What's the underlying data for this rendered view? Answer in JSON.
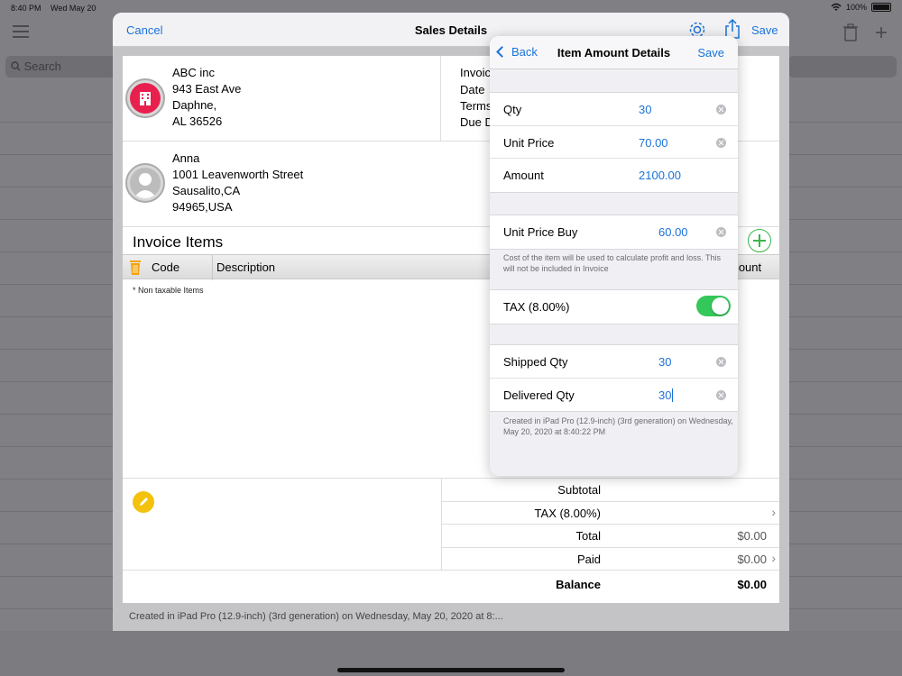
{
  "status_bar": {
    "time": "8:40 PM",
    "date": "Wed May 20",
    "battery": "100%"
  },
  "background": {
    "search_placeholder": "Search"
  },
  "sheet": {
    "cancel_label": "Cancel",
    "title": "Sales Details",
    "save_label": "Save",
    "company": {
      "name": "ABC inc",
      "street": "943 East Ave",
      "city": "Daphne,",
      "state_zip": "AL 36526"
    },
    "invoice_meta": {
      "invoice": "Invoic",
      "date": "Date",
      "terms": "Terms",
      "due": "Due D"
    },
    "client": {
      "name": "Anna",
      "street": "1001  Leavenworth Street",
      "city": "Sausalito,CA",
      "zip": "94965,USA"
    },
    "items_title": "Invoice Items",
    "columns": {
      "code": "Code",
      "description": "Description",
      "amount": "mount"
    },
    "nontax_note": "* Non taxable Items",
    "totals": [
      {
        "label": "Subtotal",
        "value": "",
        "chevron": false
      },
      {
        "label": "TAX (8.00%)",
        "value": "",
        "chevron": true
      },
      {
        "label": "Total",
        "value": "$0.00",
        "chevron": false
      },
      {
        "label": "Paid",
        "value": "$0.00",
        "chevron": true
      }
    ],
    "balance": {
      "label": "Balance",
      "value": "$0.00"
    },
    "footer_note": "Created in iPad Pro (12.9-inch) (3rd generation) on Wednesday, May 20, 2020 at 8:..."
  },
  "popover": {
    "back_label": "Back",
    "title": "Item Amount Details",
    "save_label": "Save",
    "qty": {
      "label": "Qty",
      "value": "30"
    },
    "unit_price": {
      "label": "Unit Price",
      "value": "70.00"
    },
    "amount": {
      "label": "Amount",
      "value": "2100.00"
    },
    "unit_price_buy": {
      "label": "Unit Price Buy",
      "value": "60.00"
    },
    "buy_note": "Cost of the item will be used to calculate profit and loss. This will not be included in Invoice",
    "tax": {
      "label": "TAX (8.00%)",
      "enabled": true
    },
    "shipped_qty": {
      "label": "Shipped Qty",
      "value": "30"
    },
    "delivered_qty": {
      "label": "Delivered Qty",
      "value": "30"
    },
    "created_note": "Created in iPad Pro (12.9-inch) (3rd generation) on Wednesday, May 20, 2020 at 8:40:22 PM"
  },
  "colors": {
    "accent": "#1a73d9",
    "toggle_on": "#34c759",
    "add_button": "#3ab54a",
    "notes_icon": "#f4c20d",
    "company_icon": "#e8204e"
  }
}
